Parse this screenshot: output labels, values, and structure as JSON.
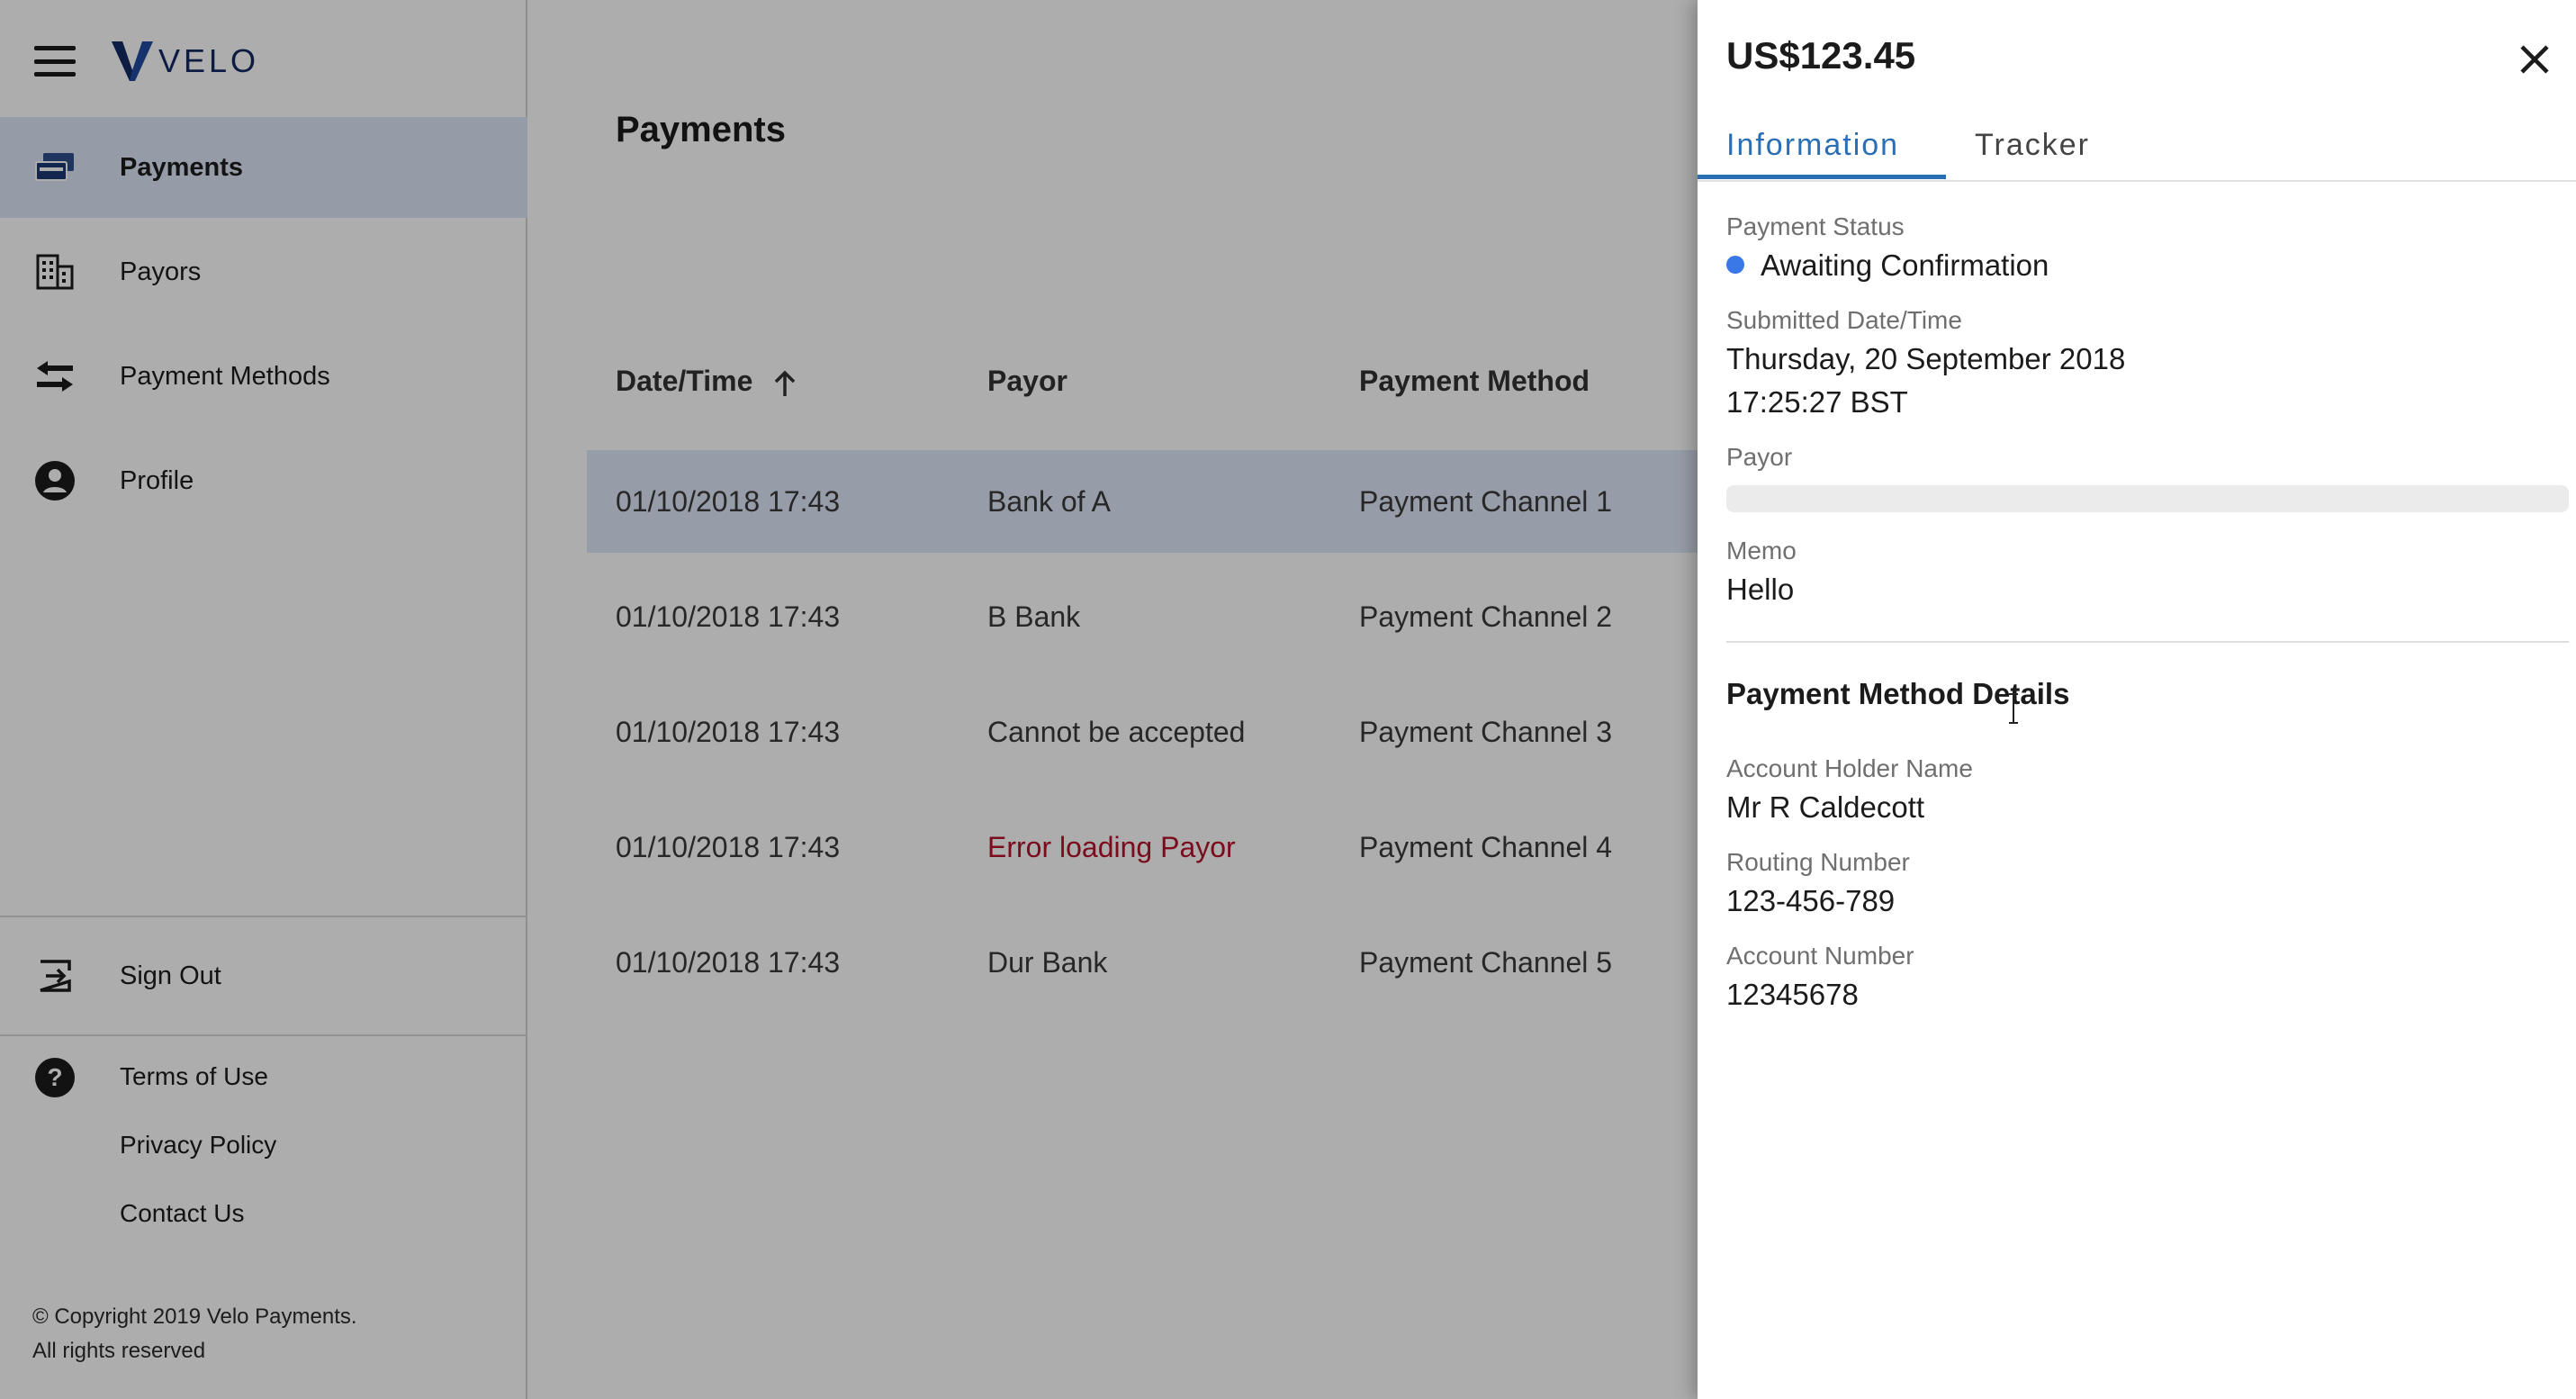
{
  "app": {
    "brand": "VELO"
  },
  "sidebar": {
    "items": [
      {
        "label": "Payments",
        "icon": "payments-icon",
        "active": true
      },
      {
        "label": "Payors",
        "icon": "building-icon"
      },
      {
        "label": "Payment Methods",
        "icon": "swap-arrows-icon"
      },
      {
        "label": "Profile",
        "icon": "account-circle-icon"
      }
    ],
    "sign_out": "Sign Out",
    "terms": "Terms of Use",
    "privacy": "Privacy Policy",
    "contact": "Contact Us",
    "copyright_line1": "© Copyright 2019 Velo Payments.",
    "copyright_line2": "All rights reserved"
  },
  "main": {
    "title": "Payments",
    "columns": {
      "datetime": "Date/Time",
      "payor": "Payor",
      "method": "Payment Method"
    },
    "rows": [
      {
        "datetime": "01/10/2018 17:43",
        "payor": "Bank of A",
        "method": "Payment Channel 1"
      },
      {
        "datetime": "01/10/2018 17:43",
        "payor": "B Bank",
        "method": "Payment Channel 2"
      },
      {
        "datetime": "01/10/2018 17:43",
        "payor": "Cannot be accepted",
        "method": "Payment Channel 3"
      },
      {
        "datetime": "01/10/2018 17:43",
        "payor": "Error loading Payor",
        "method": "Payment Channel 4"
      },
      {
        "datetime": "01/10/2018 17:43",
        "payor": "Dur Bank",
        "method": "Payment Channel 5"
      }
    ]
  },
  "drawer": {
    "amount": "US$123.45",
    "tabs": [
      "Information",
      "Tracker"
    ],
    "payment_status_label": "Payment Status",
    "payment_status": "Awaiting Confirmation",
    "submitted_label": "Submitted Date/Time",
    "submitted_date": "Thursday, 20 September 2018",
    "submitted_time": "17:25:27 BST",
    "payor_label": "Payor",
    "memo_label": "Memo",
    "memo": "Hello",
    "details_title": "Payment Method Details",
    "account_holder_label": "Account Holder Name",
    "account_holder": "Mr R Caldecott",
    "routing_label": "Routing Number",
    "routing": "123-456-789",
    "account_number_label": "Account Number",
    "account_number": "12345678"
  },
  "colors": {
    "accent": "#2a6fb5",
    "status_dot": "#3b78e7",
    "error": "#b5122b",
    "selected_row": "#dde6f8"
  }
}
